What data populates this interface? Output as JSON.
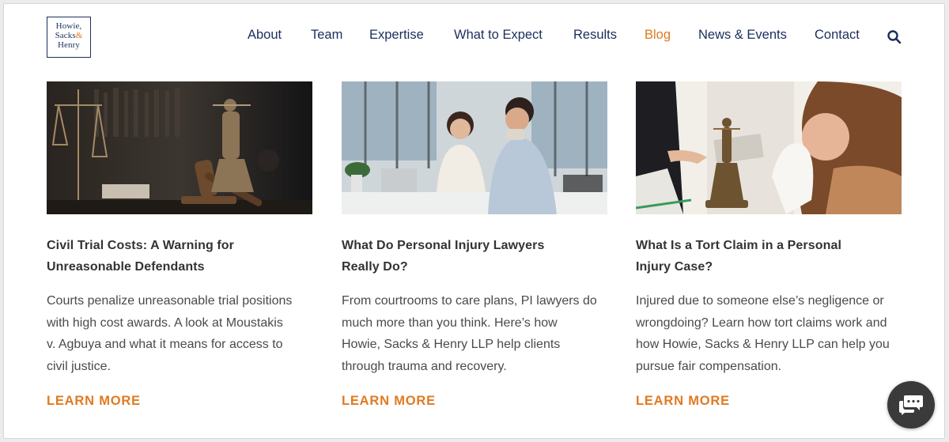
{
  "logo": {
    "line1": "Howie,",
    "line2a": "Sacks",
    "line2amp": "&",
    "line3": "Henry"
  },
  "nav": [
    {
      "label": "About"
    },
    {
      "label": "Team"
    },
    {
      "label": "Expertise"
    },
    {
      "label": "What to Expect"
    },
    {
      "label": "Results"
    },
    {
      "label": "Blog"
    },
    {
      "label": "News & Events"
    },
    {
      "label": "Contact"
    }
  ],
  "posts": [
    {
      "title_l1": "Civil Trial Costs: A Warning for",
      "title_l2": "Unreasonable Defendants",
      "desc": "Courts penalize unreasonable trial positions\nwith high cost awards. A look at Moustakis\nv. Agbuya and what it means for access to\ncivil justice.",
      "more": "LEARN MORE"
    },
    {
      "title_l1": "What Do Personal Injury Lawyers",
      "title_l2": "Really Do?",
      "desc": "From courtrooms to care plans, PI lawyers do\nmuch more than you think. Here’s how\nHowie, Sacks & Henry LLP help clients\nthrough trauma and recovery.",
      "more": "LEARN MORE"
    },
    {
      "title_l1": "What Is a Tort Claim in a Personal",
      "title_l2": "Injury Case?",
      "desc": "Injured due to someone else’s negligence or\nwrongdoing? Learn how tort claims work and\nhow Howie, Sacks & Henry LLP can help you\npursue fair compensation.",
      "more": "LEARN MORE"
    }
  ],
  "colors": {
    "navy": "#1b2f5c",
    "orange": "#e07a21",
    "text": "#4a4a4a",
    "chat": "#3a3a3a"
  },
  "icons": {
    "search": "search-icon",
    "chat": "chat-bubble-icon"
  }
}
